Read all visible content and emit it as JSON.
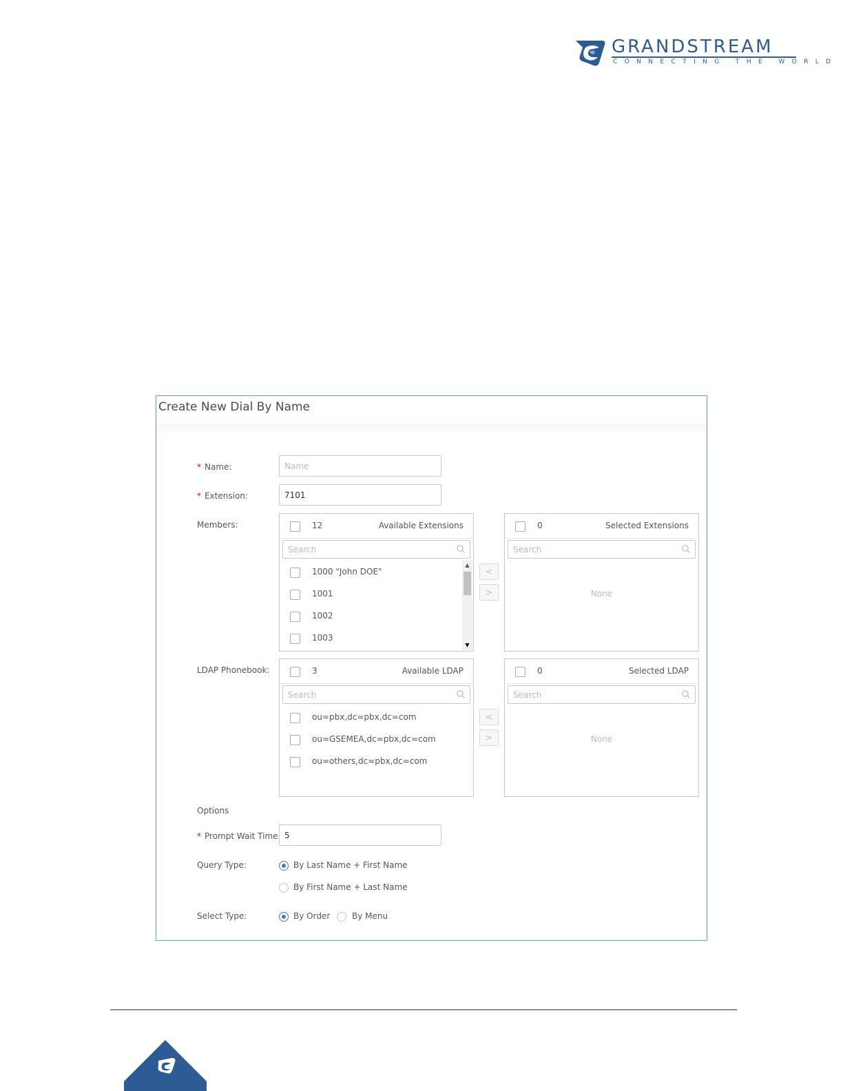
{
  "header": {
    "brand": "GRANDSTREAM",
    "tagline": "CONNECTING THE WORLD",
    "brand_color": "#2d5c95"
  },
  "dialog": {
    "title": "Create New Dial By Name",
    "name": {
      "label": "Name:",
      "placeholder": "Name",
      "value": ""
    },
    "extension": {
      "label": "Extension:",
      "value": "7101"
    },
    "members": {
      "label": "Members:",
      "available": {
        "count": "12",
        "title": "Available Extensions",
        "search_placeholder": "Search",
        "items": [
          "1000 \"John DOE\"",
          "1001",
          "1002",
          "1003"
        ]
      },
      "selected": {
        "count": "0",
        "title": "Selected Extensions",
        "search_placeholder": "Search",
        "empty_text": "None"
      }
    },
    "ldap": {
      "label": "LDAP Phonebook:",
      "available": {
        "count": "3",
        "title": "Available LDAP",
        "search_placeholder": "Search",
        "items": [
          "ou=pbx,dc=pbx,dc=com",
          "ou=GSEMEA,dc=pbx,dc=com",
          "ou=others,dc=pbx,dc=com"
        ]
      },
      "selected": {
        "count": "0",
        "title": "Selected LDAP",
        "search_placeholder": "Search",
        "empty_text": "None"
      }
    },
    "transfer_left": "<",
    "transfer_right": ">",
    "options_label": "Options",
    "prompt_wait": {
      "label": "Prompt Wait Time...",
      "value": "5"
    },
    "query_type": {
      "label": "Query Type:",
      "options": [
        "By Last Name + First Name",
        "By First Name + Last Name"
      ],
      "selected": "By Last Name + First Name"
    },
    "select_type": {
      "label": "Select Type:",
      "options": [
        "By Order",
        "By Menu"
      ],
      "selected": "By Order"
    },
    "required_mark": "*"
  }
}
